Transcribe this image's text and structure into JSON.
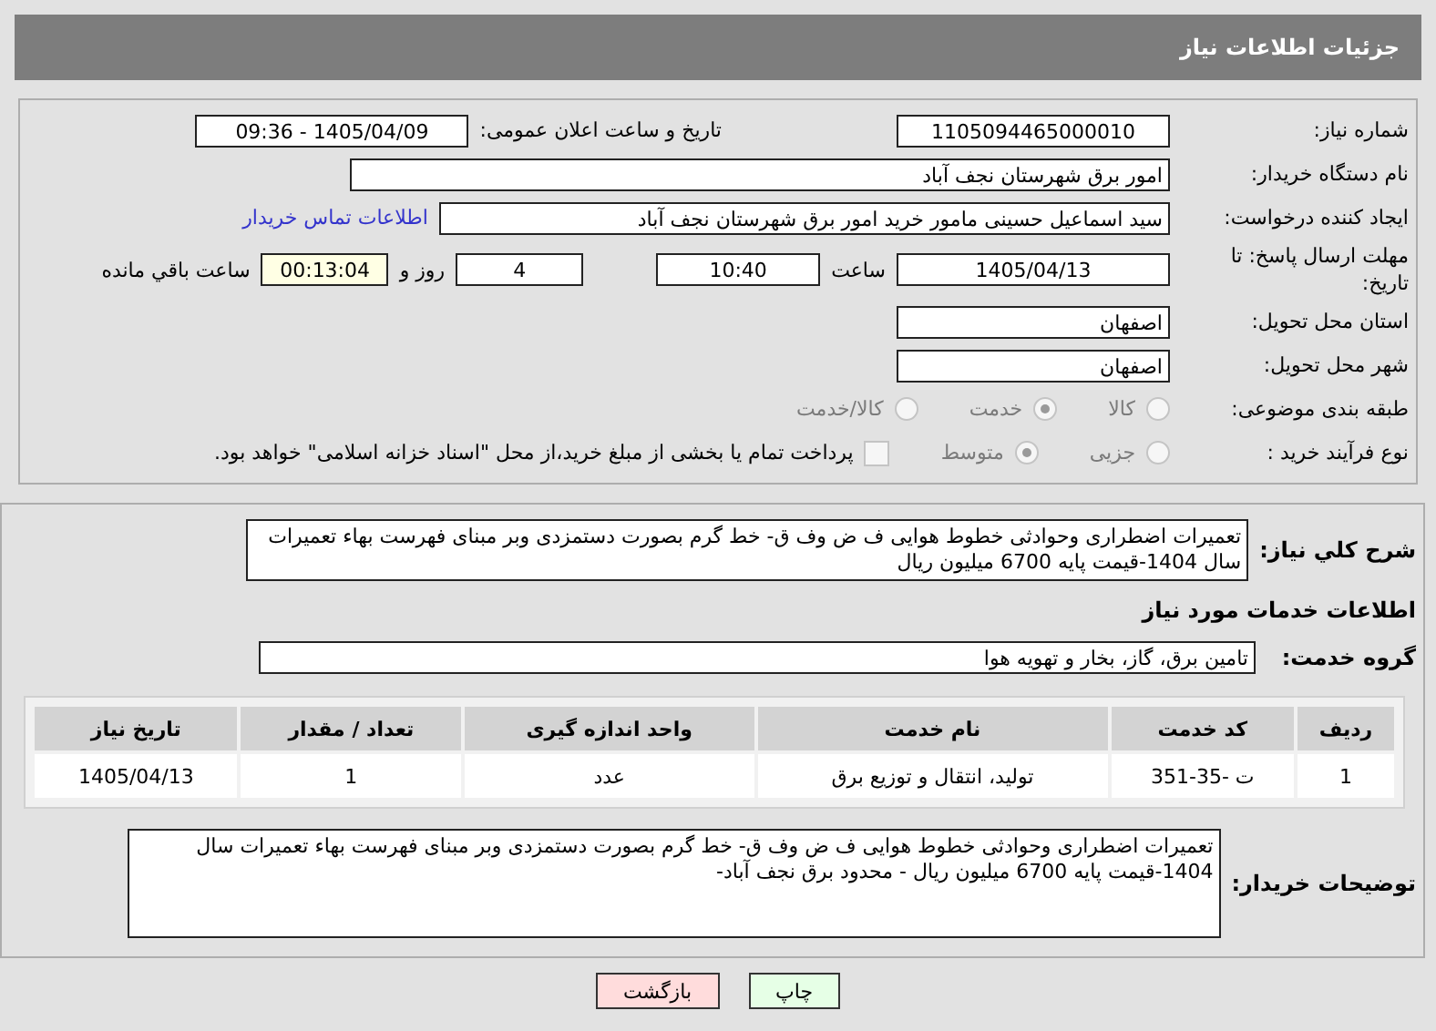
{
  "header": {
    "title": "جزئیات اطلاعات نیاز"
  },
  "need_number": {
    "label": "شماره نیاز:",
    "value": "1105094465000010"
  },
  "announce": {
    "label": "تاریخ و ساعت اعلان عمومی:",
    "value": "1405/04/09 - 09:36"
  },
  "buyer_org": {
    "label": "نام دستگاه خریدار:",
    "value": "امور برق شهرستان نجف آباد"
  },
  "creator": {
    "label": "ایجاد کننده درخواست:",
    "value": "سید اسماعیل  حسینی  مامور خرید  امور برق شهرستان نجف آباد",
    "link": "اطلاعات تماس خریدار"
  },
  "deadline": {
    "label": "مهلت ارسال پاسخ: تا تاریخ:",
    "date": "1405/04/13",
    "time_label": "ساعت",
    "time": "10:40",
    "days": "4",
    "days_label": "روز و",
    "remaining": "00:13:04",
    "remaining_label": "ساعت باقي مانده"
  },
  "province": {
    "label": "استان محل تحویل:",
    "value": "اصفهان"
  },
  "city": {
    "label": "شهر محل تحویل:",
    "value": "اصفهان"
  },
  "category": {
    "label": "طبقه بندی موضوعی:",
    "options": [
      {
        "label": "کالا",
        "selected": false
      },
      {
        "label": "خدمت",
        "selected": true
      },
      {
        "label": "کالا/خدمت",
        "selected": false
      }
    ]
  },
  "process": {
    "label": "نوع فرآیند خرید :",
    "options": [
      {
        "label": "جزیی",
        "selected": false
      },
      {
        "label": "متوسط",
        "selected": true
      }
    ],
    "treasury": {
      "checked": false,
      "text": "پرداخت تمام یا بخشی از مبلغ خرید،از محل \"اسناد خزانه اسلامی\" خواهد بود."
    }
  },
  "description": {
    "label": "شرح کلي نياز:",
    "value": "تعمیرات اضطراری وحوادثی خطوط هوایی ف ض وف ق- خط گرم بصورت دستمزدی وبر مبنای فهرست بهاء تعمیرات سال  1404-قیمت پایه 6700 میلیون ریال"
  },
  "services_heading": "اطلاعات خدمات مورد نیاز",
  "service_group": {
    "label": "گروه خدمت:",
    "value": "تامین برق، گاز، بخار و تهویه هوا"
  },
  "table": {
    "columns": [
      "ردیف",
      "کد خدمت",
      "نام خدمت",
      "واحد اندازه گیری",
      "تعداد / مقدار",
      "تاریخ نیاز"
    ],
    "rows": [
      [
        "1",
        "ت -35-351",
        "تولید، انتقال و توزیع برق",
        "عدد",
        "1",
        "1405/04/13"
      ]
    ]
  },
  "buyer_notes": {
    "label": "توضیحات خریدار:",
    "value": "تعمیرات اضطراری وحوادثی خطوط هوایی ف ض وف ق- خط گرم بصورت دستمزدی وبر مبنای فهرست بهاء تعمیرات سال 1404-قیمت پایه 6700 میلیون ریال - محدود برق نجف آباد-"
  },
  "buttons": [
    {
      "label": "چاپ",
      "kind": "print"
    },
    {
      "label": "بازگشت",
      "kind": "back"
    }
  ]
}
